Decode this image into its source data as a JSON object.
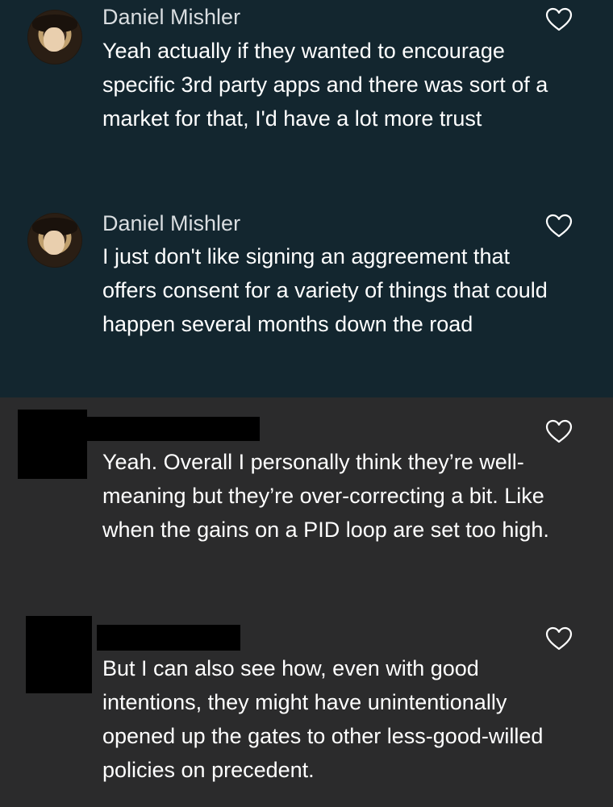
{
  "comments": [
    {
      "author": "Daniel Mishler",
      "text": "Yeah actually if they wanted to encourage specific 3rd party apps and there was sort of a market for that, I'd have a lot more trust",
      "avatar_icon": "portrait-avatar",
      "like_icon": "heart-outline-icon",
      "highlighted": true
    },
    {
      "author": "Daniel Mishler",
      "text": "I just don't like signing an aggreement that offers consent for a variety of things that could happen several months down the road",
      "avatar_icon": "portrait-avatar",
      "like_icon": "heart-outline-icon",
      "highlighted": true
    },
    {
      "author": "",
      "text": "Yeah. Overall I personally think they’re well-meaning but they’re over-correcting a bit. Like when the gains on a PID loop are set too high.",
      "avatar_icon": "redacted",
      "like_icon": "heart-outline-icon",
      "highlighted": false
    },
    {
      "author": "",
      "text": "But I can also see how, even with good intentions, they might have unintentionally opened up the gates to other less-good-willed policies on precedent.",
      "avatar_icon": "redacted",
      "like_icon": "heart-outline-icon",
      "highlighted": false
    }
  ],
  "colors": {
    "highlight_bg": "#13262f",
    "plain_bg": "#2b2b2c",
    "text": "#ffffff",
    "author": "#d9dde0",
    "redaction": "#000000"
  }
}
